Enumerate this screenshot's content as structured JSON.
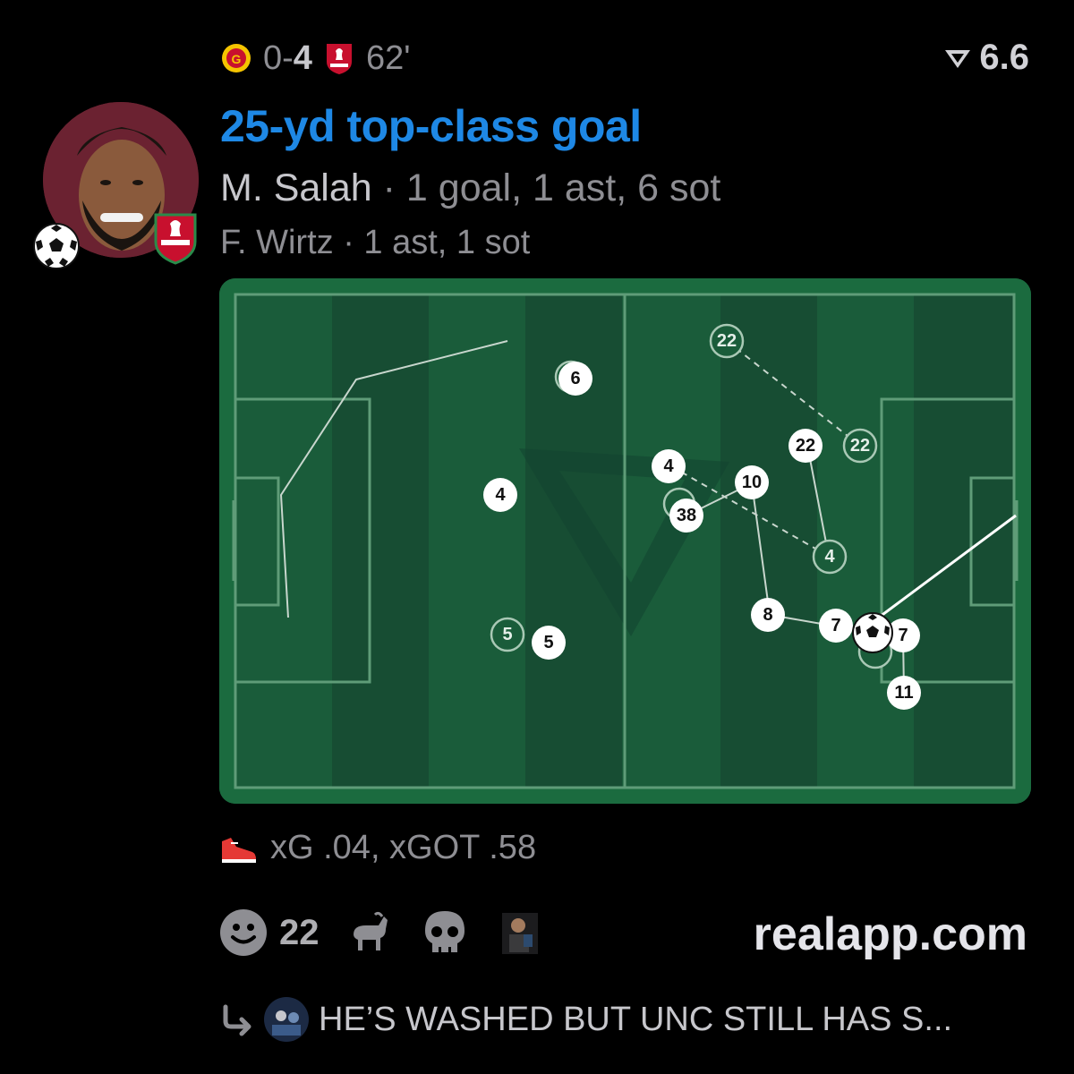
{
  "header": {
    "home_score": "0",
    "separator": "-",
    "away_score": "4",
    "minute": "62'",
    "rating": "6.6"
  },
  "event": {
    "title": "25-yd top-class goal",
    "scorer_name": "M. Salah",
    "scorer_stats": "· 1 goal, 1 ast, 6 sot",
    "assist_line": "F. Wirtz · 1 ast, 1 sot"
  },
  "shot": {
    "icon": "shoe-icon",
    "stats": "xG .04, xGOT .58"
  },
  "reactions": {
    "smile_count": "22",
    "icons": [
      "smile-icon",
      "goat-icon",
      "skull-icon",
      "user-avatar"
    ]
  },
  "footer": {
    "site": "realapp.com",
    "reply_text": "HE’S WASHED BUT UNC STILL HAS S..."
  },
  "pitch": {
    "numbers_shown": [
      "6",
      "22",
      "22",
      "22",
      "4",
      "4",
      "10",
      "38",
      "4",
      "5",
      "5",
      "8",
      "7",
      "7",
      "11"
    ]
  },
  "colors": {
    "title_blue": "#1e88e5",
    "pitch_green": "#1b6b3f",
    "pitch_stripe_dark": "#17563a",
    "muted_text": "#8e8e93"
  }
}
